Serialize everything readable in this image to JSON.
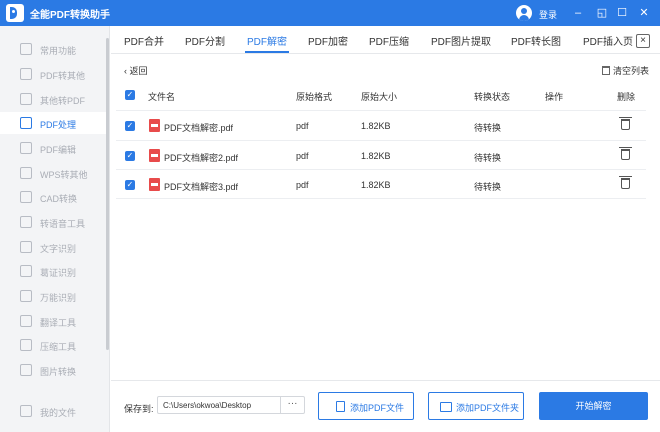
{
  "app": {
    "title": "全能PDF转换助手",
    "login": "登录"
  },
  "window": {
    "minimize": "–",
    "restore": "◱",
    "maximize": "☐",
    "close": "✕"
  },
  "sidebar": {
    "items": [
      {
        "label": "常用功能",
        "active": false
      },
      {
        "label": "PDF转其他",
        "active": false
      },
      {
        "label": "其他转PDF",
        "active": false
      },
      {
        "label": "PDF处理",
        "active": true
      },
      {
        "label": "PDF编辑",
        "active": false
      },
      {
        "label": "WPS转其他",
        "active": false
      },
      {
        "label": "CAD转换",
        "active": false
      },
      {
        "label": "转语音工具",
        "active": false
      },
      {
        "label": "文字识别",
        "active": false
      },
      {
        "label": "葛证识别",
        "active": false
      },
      {
        "label": "万能识别",
        "active": false
      },
      {
        "label": "翻译工具",
        "active": false
      },
      {
        "label": "压缩工具",
        "active": false
      },
      {
        "label": "图片转换",
        "active": false
      },
      {
        "label": "我的文件",
        "active": false
      }
    ]
  },
  "tabs": [
    {
      "label": "PDF合并",
      "active": false
    },
    {
      "label": "PDF分割",
      "active": false
    },
    {
      "label": "PDF解密",
      "active": true
    },
    {
      "label": "PDF加密",
      "active": false
    },
    {
      "label": "PDF压缩",
      "active": false
    },
    {
      "label": "PDF图片提取",
      "active": false
    },
    {
      "label": "PDF转长图",
      "active": false
    },
    {
      "label": "PDF插入页",
      "active": false
    }
  ],
  "tab_close": "×",
  "toolbar": {
    "back": "返回",
    "back_icon": "‹",
    "clear": "清空列表"
  },
  "table": {
    "headers": {
      "name": "文件名",
      "format": "原始格式",
      "size": "原始大小",
      "status": "转换状态",
      "action": "操作",
      "delete": "删除"
    },
    "rows": [
      {
        "name": "PDF文档解密.pdf",
        "format": "pdf",
        "size": "1.82KB",
        "status": "待转换"
      },
      {
        "name": "PDF文档解密2.pdf",
        "format": "pdf",
        "size": "1.82KB",
        "status": "待转换"
      },
      {
        "name": "PDF文档解密3.pdf",
        "format": "pdf",
        "size": "1.82KB",
        "status": "待转换"
      }
    ]
  },
  "footer": {
    "save_label": "保存到:",
    "path": "C:\\Users\\okwoa\\Desktop",
    "browse": "···",
    "add_file": "添加PDF文件",
    "add_folder": "添加PDF文件夹",
    "start": "开始解密"
  },
  "colors": {
    "accent": "#2b7ae4",
    "pdf_icon": "#e84b4b"
  }
}
